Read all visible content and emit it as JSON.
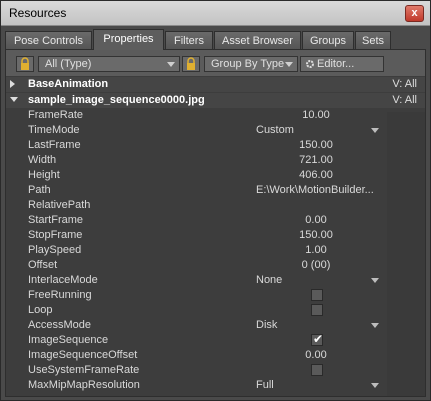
{
  "window": {
    "title": "Resources",
    "close_glyph": "x"
  },
  "tabs": [
    {
      "label": "Pose Controls"
    },
    {
      "label": "Properties"
    },
    {
      "label": "Filters"
    },
    {
      "label": "Asset Browser"
    },
    {
      "label": "Groups"
    },
    {
      "label": "Sets"
    }
  ],
  "toolbar": {
    "type_filter": "All (Type)",
    "group_by": "Group By Type",
    "editor_label": "Editor..."
  },
  "groups": [
    {
      "label": "BaseAnimation",
      "v": "V: All",
      "expanded": false
    },
    {
      "label": "sample_image_sequence0000.jpg",
      "v": "V: All",
      "expanded": true
    }
  ],
  "properties": [
    {
      "name": "FrameRate",
      "value": "10.00",
      "kind": "num"
    },
    {
      "name": "TimeMode",
      "value": "Custom",
      "kind": "enum"
    },
    {
      "name": "LastFrame",
      "value": "150.00",
      "kind": "num"
    },
    {
      "name": "Width",
      "value": "721.00",
      "kind": "num"
    },
    {
      "name": "Height",
      "value": "406.00",
      "kind": "num"
    },
    {
      "name": "Path",
      "value": "E:\\Work\\MotionBuilder...",
      "kind": "text"
    },
    {
      "name": "RelativePath",
      "value": "",
      "kind": "text"
    },
    {
      "name": "StartFrame",
      "value": "0.00",
      "kind": "num"
    },
    {
      "name": "StopFrame",
      "value": "150.00",
      "kind": "num"
    },
    {
      "name": "PlaySpeed",
      "value": "1.00",
      "kind": "num"
    },
    {
      "name": "Offset",
      "value": "0 (00)",
      "kind": "num"
    },
    {
      "name": "InterlaceMode",
      "value": "None",
      "kind": "enum"
    },
    {
      "name": "FreeRunning",
      "value": "",
      "kind": "check",
      "checked": false
    },
    {
      "name": "Loop",
      "value": "",
      "kind": "check",
      "checked": false
    },
    {
      "name": "AccessMode",
      "value": "Disk",
      "kind": "enum"
    },
    {
      "name": "ImageSequence",
      "value": "",
      "kind": "check",
      "checked": true
    },
    {
      "name": "ImageSequenceOffset",
      "value": "0.00",
      "kind": "num"
    },
    {
      "name": "UseSystemFrameRate",
      "value": "",
      "kind": "check",
      "checked": false
    },
    {
      "name": "MaxMipMapResolution",
      "value": "Full",
      "kind": "enum"
    }
  ]
}
